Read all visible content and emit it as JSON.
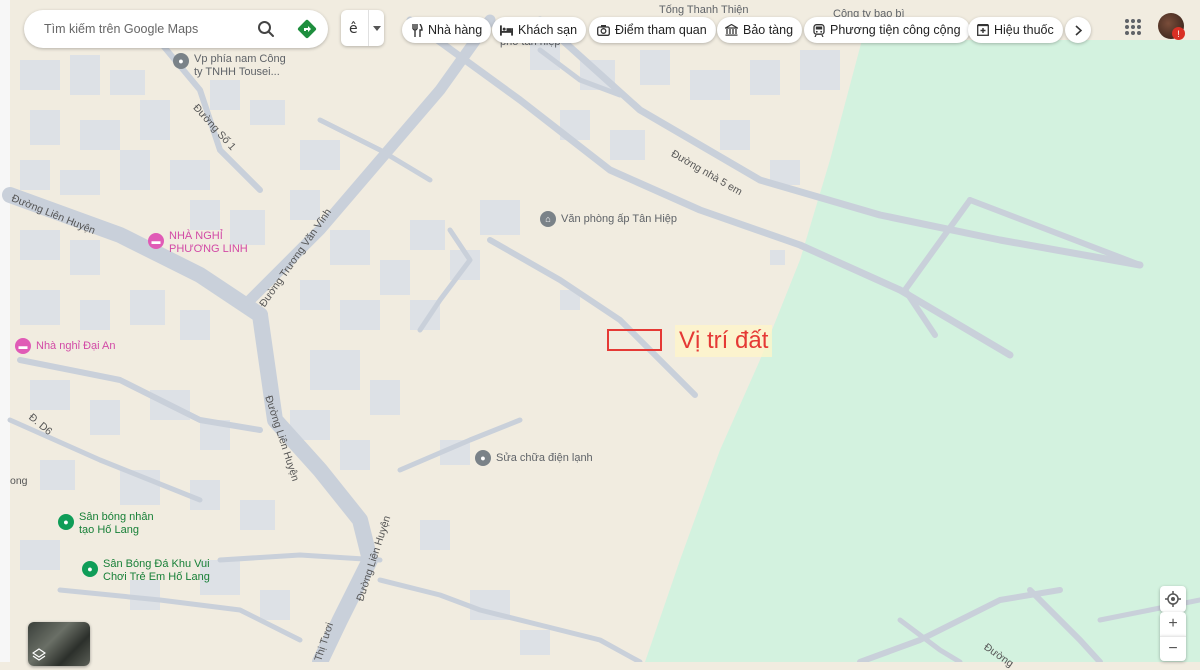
{
  "search": {
    "placeholder": "Tìm kiếm trên Google Maps"
  },
  "chips": [
    {
      "label": "Nhà hàng",
      "icon": "restaurant-icon"
    },
    {
      "label": "Khách sạn",
      "icon": "hotel-icon"
    },
    {
      "label": "Điểm tham quan",
      "icon": "camera-icon"
    },
    {
      "label": "Bảo tàng",
      "icon": "museum-icon"
    },
    {
      "label": "Phương tiện công cộng",
      "icon": "transit-icon"
    },
    {
      "label": "Hiệu thuốc",
      "icon": "pharmacy-icon"
    }
  ],
  "pois": [
    {
      "name": "Vp phía nam Công ty TNHH Tousei ...",
      "line1": "Vp phía nam Công",
      "line2": "ty TNHH Tousei...",
      "kind": "gray"
    },
    {
      "name": "Văn phòng ấp Tân Hiệp",
      "kind": "gray"
    },
    {
      "name": "Sửa chữa điện lạnh",
      "kind": "gray"
    },
    {
      "name": "NHÀ NGHỈ PHƯƠNG LINH",
      "line1": "NHÀ NGHỈ",
      "line2": "PHƯƠNG LINH",
      "kind": "pink"
    },
    {
      "name": "Nhà nghỉ Đại An",
      "kind": "pink"
    },
    {
      "name": "Sân bóng nhân tạo Hố Lang",
      "line1": "Sân bóng nhân",
      "line2": "tạo Hố Lang",
      "kind": "green"
    },
    {
      "name": "Sân Bóng Đá Khu Vui Chơi Trẻ Em Hố Lang",
      "line1": "Sân Bóng Đá Khu Vui",
      "line2": "Chơi Trẻ Em Hố Lang",
      "kind": "green"
    }
  ],
  "top_labels": {
    "tong_thanh_thien": "Tống Thanh Thiện",
    "cong_ty": "Công ty bao bì",
    "tan_hiep": "phố tân hiệp"
  },
  "roads": {
    "duong_so_1": "Đường Số 1",
    "lien_huyen_1": "Đường Liên Huyện",
    "truong_van_vinh": "Đường Trương Văn Vĩnh",
    "lien_huyen_2": "Đường Liên Huyện",
    "lien_huyen_3": "Đường Liên Huyện",
    "nha_5_em": "Đường nhà 5 em",
    "d6": "Đ. D6",
    "thi_tuoi": "Thị Tươi",
    "duong_right": "Đường",
    "ong": "ong"
  },
  "marker": {
    "label": "Vị trí đất",
    "color": "#e53935"
  },
  "colors": {
    "land": "#f1ece0",
    "park": "#d3f2df",
    "road": "#c9d0da",
    "building": "#dfe3e8"
  },
  "controls": {
    "zoom_in": "+",
    "zoom_out": "−"
  }
}
